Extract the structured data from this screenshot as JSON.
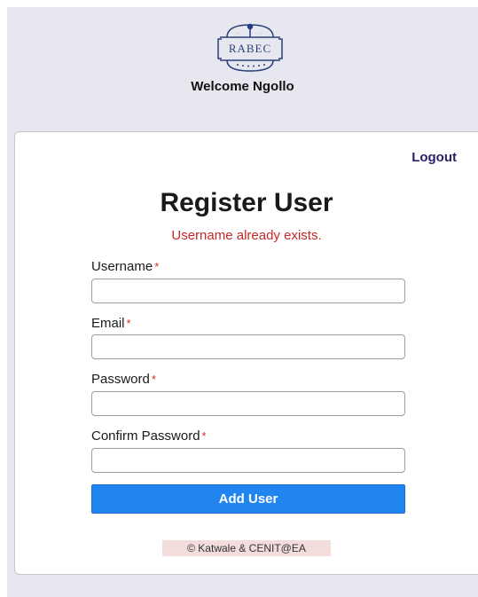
{
  "header": {
    "logo_text": "RABEC",
    "welcome_text": "Welcome Ngollo"
  },
  "nav": {
    "logout_label": "Logout"
  },
  "form": {
    "title": "Register User",
    "error_message": "Username already exists.",
    "required_marker": "*",
    "fields": [
      {
        "label": "Username",
        "value": "",
        "placeholder": ""
      },
      {
        "label": "Email",
        "value": "",
        "placeholder": ""
      },
      {
        "label": "Password",
        "value": "",
        "placeholder": ""
      },
      {
        "label": "Confirm Password",
        "value": "",
        "placeholder": ""
      }
    ],
    "submit_label": "Add User"
  },
  "footer": {
    "text": "© Katwale & CENIT@EA"
  },
  "colors": {
    "page_background": "#e7e7ef",
    "card_background": "#ffffff",
    "logout_text": "#2c1e66",
    "error_text": "#c62828",
    "required_marker": "#d32f2f",
    "button_background": "#2185f0",
    "footer_highlight": "#f3dcdc",
    "logo_stroke": "#2a3f7a"
  },
  "icons": {
    "logo": "rabec-logo-icon"
  }
}
